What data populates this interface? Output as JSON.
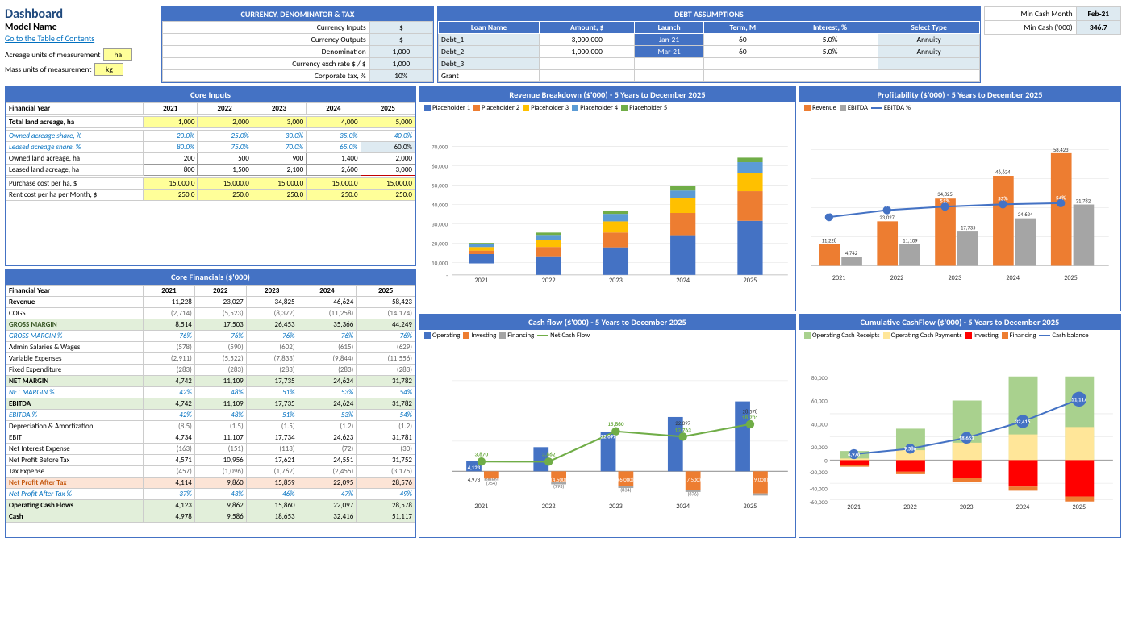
{
  "header": {
    "title_dashboard": "Dashboard",
    "title_model": "Model Name",
    "link_toc": "Go to the Table of Contents",
    "acreage_label": "Acreage units of measurement",
    "acreage_value": "ha",
    "mass_label": "Mass units of measurement",
    "mass_value": "kg"
  },
  "currency": {
    "title": "CURRENCY, DENOMINATOR & TAX",
    "rows": [
      {
        "label": "Currency Inputs",
        "value": "$"
      },
      {
        "label": "Currency Outputs",
        "value": "$"
      },
      {
        "label": "Denomination",
        "value": "1,000"
      },
      {
        "label": "Currency exch rate $ / $",
        "value": "1,000"
      },
      {
        "label": "Corporate tax, %",
        "value": "10%"
      }
    ]
  },
  "debt": {
    "title": "DEBT ASSUMPTIONS",
    "headers": [
      "Loan Name",
      "Amount, $",
      "Launch",
      "Term, M",
      "Interest, %",
      "Select Type"
    ],
    "rows": [
      {
        "name": "Debt_1",
        "amount": "3,000,000",
        "launch": "Jan-21",
        "term": "60",
        "interest": "5.0%",
        "type": "Annuity"
      },
      {
        "name": "Debt_2",
        "amount": "1,000,000",
        "launch": "Mar-21",
        "term": "60",
        "interest": "5.0%",
        "type": "Annuity"
      },
      {
        "name": "Debt_3",
        "amount": "",
        "launch": "",
        "term": "",
        "interest": "",
        "type": ""
      },
      {
        "name": "Grant",
        "amount": "",
        "launch": "",
        "term": "",
        "interest": "",
        "type": ""
      }
    ]
  },
  "mincash": {
    "label1": "Min Cash Month",
    "value1": "Feb-21",
    "label2": "Min Cash ('000)",
    "value2": "346.7"
  },
  "core_inputs": {
    "title": "Core Inputs",
    "fy_label": "Financial Year",
    "years": [
      "2021",
      "2022",
      "2023",
      "2024",
      "2025"
    ],
    "rows": [
      {
        "label": "Total land acreage, ha",
        "type": "yellow",
        "values": [
          "1,000",
          "2,000",
          "3,000",
          "4,000",
          "5,000"
        ]
      },
      {
        "label": "Owned acreage share, %",
        "type": "italic_blue",
        "values": [
          "20.0%",
          "25.0%",
          "30.0%",
          "35.0%",
          "40.0%"
        ]
      },
      {
        "label": "Leased acreage share, %",
        "type": "italic_blue",
        "values": [
          "80.0%",
          "75.0%",
          "70.0%",
          "65.0%",
          "60.0%"
        ]
      },
      {
        "label": "Owned land acreage, ha",
        "type": "bordered",
        "values": [
          "200",
          "500",
          "900",
          "1,400",
          "2,000"
        ]
      },
      {
        "label": "Leased land acreage, ha",
        "type": "bordered",
        "values": [
          "800",
          "1,500",
          "2,100",
          "2,600",
          "3,000"
        ]
      },
      {
        "label": "Purchase cost per ha, $",
        "type": "yellow",
        "values": [
          "15,000.0",
          "15,000.0",
          "15,000.0",
          "15,000.0",
          "15,000.0"
        ]
      },
      {
        "label": "Rent cost per ha per Month, $",
        "type": "yellow",
        "values": [
          "250.0",
          "250.0",
          "250.0",
          "250.0",
          "250.0"
        ]
      }
    ]
  },
  "core_financials": {
    "title": "Core Financials ($'000)",
    "fy_label": "Financial Year",
    "years": [
      "2021",
      "2022",
      "2023",
      "2024",
      "2025"
    ],
    "rows": [
      {
        "label": "Revenue",
        "style": "bold",
        "values": [
          "11,228",
          "23,027",
          "34,825",
          "46,624",
          "58,423"
        ]
      },
      {
        "label": "COGS",
        "style": "normal",
        "values": [
          "(2,714)",
          "(5,523)",
          "(8,372)",
          "(11,258)",
          "(14,174)"
        ]
      },
      {
        "label": "GROSS MARGIN",
        "style": "green_bold",
        "values": [
          "8,514",
          "17,503",
          "26,453",
          "35,366",
          "44,249"
        ]
      },
      {
        "label": "GROSS MARGIN %",
        "style": "blue_italic",
        "values": [
          "76%",
          "76%",
          "76%",
          "76%",
          "76%"
        ]
      },
      {
        "label": "Admin Salaries & Wages",
        "style": "normal",
        "values": [
          "(578)",
          "(590)",
          "(602)",
          "(615)",
          "(629)"
        ]
      },
      {
        "label": "Variable Expenses",
        "style": "normal",
        "values": [
          "(2,911)",
          "(5,522)",
          "(7,833)",
          "(9,844)",
          "(11,556)"
        ]
      },
      {
        "label": "Fixed Expenditure",
        "style": "normal",
        "values": [
          "(283)",
          "(283)",
          "(283)",
          "(283)",
          "(283)"
        ]
      },
      {
        "label": "NET MARGIN",
        "style": "bold",
        "values": [
          "4,742",
          "11,109",
          "17,735",
          "24,624",
          "31,782"
        ]
      },
      {
        "label": "NET MARGIN %",
        "style": "blue_italic",
        "values": [
          "42%",
          "48%",
          "51%",
          "53%",
          "54%"
        ]
      },
      {
        "label": "EBITDA",
        "style": "bold",
        "values": [
          "4,742",
          "11,109",
          "17,735",
          "24,624",
          "31,782"
        ]
      },
      {
        "label": "EBITDA %",
        "style": "blue_italic",
        "values": [
          "42%",
          "48%",
          "51%",
          "53%",
          "54%"
        ]
      },
      {
        "label": "Depreciation & Amortization",
        "style": "normal",
        "values": [
          "(8.5)",
          "(1.5)",
          "(1.5)",
          "(1.2)",
          "(1.2)"
        ]
      },
      {
        "label": "EBIT",
        "style": "normal",
        "values": [
          "4,734",
          "11,107",
          "17,734",
          "24,623",
          "31,781"
        ]
      },
      {
        "label": "Net Interest Expense",
        "style": "normal",
        "values": [
          "(163)",
          "(151)",
          "(113)",
          "(72)",
          "(30)"
        ]
      },
      {
        "label": "Net Profit Before Tax",
        "style": "normal",
        "values": [
          "4,571",
          "10,956",
          "17,621",
          "24,551",
          "31,752"
        ]
      },
      {
        "label": "Tax Expense",
        "style": "normal",
        "values": [
          "(457)",
          "(1,096)",
          "(1,762)",
          "(2,455)",
          "(3,175)"
        ]
      },
      {
        "label": "Net Profit After Tax",
        "style": "orange_bold",
        "values": [
          "4,114",
          "9,860",
          "15,859",
          "22,095",
          "28,576"
        ]
      },
      {
        "label": "Net Profit After Tax %",
        "style": "blue_italic",
        "values": [
          "37%",
          "43%",
          "46%",
          "47%",
          "49%"
        ]
      },
      {
        "label": "Operating Cash Flows",
        "style": "bold",
        "values": [
          "4,123",
          "9,862",
          "15,860",
          "22,097",
          "28,578"
        ]
      },
      {
        "label": "Cash",
        "style": "bold",
        "values": [
          "4,978",
          "9,586",
          "18,653",
          "32,416",
          "51,117"
        ]
      }
    ]
  },
  "revenue_chart": {
    "title": "Revenue Breakdown ($'000) - 5 Years to December 2025",
    "legend": [
      "Placeholder 1",
      "Placeholder 2",
      "Placeholder 3",
      "Placeholder 4",
      "Placeholder 5"
    ],
    "colors": [
      "#4472C4",
      "#ED7D31",
      "#FFC000",
      "#5B9BD5",
      "#70AD47"
    ],
    "years": [
      "2021",
      "2022",
      "2023",
      "2024",
      "2025"
    ],
    "max_y": 70000,
    "y_labels": [
      "70,000",
      "60,000",
      "50,000",
      "40,000",
      "30,000",
      "20,000",
      "10,000",
      "-"
    ],
    "bars": [
      [
        5000,
        2000,
        2000,
        1500,
        700
      ],
      [
        10000,
        5000,
        4000,
        2500,
        1527
      ],
      [
        15000,
        8000,
        6000,
        4000,
        1825
      ],
      [
        20000,
        12000,
        8000,
        4000,
        2624
      ],
      [
        25000,
        16000,
        10000,
        5000,
        2423
      ]
    ]
  },
  "cashflow_chart": {
    "title": "Cash flow ($'000) - 5 Years to December 2025",
    "legend": [
      "Operating",
      "Investing",
      "Financing",
      "Net Cash Flow"
    ],
    "colors": [
      "#4472C4",
      "#ED7D31",
      "#A5A5A5",
      "#70AD47"
    ],
    "years": [
      "2021",
      "2022",
      "2023",
      "2024",
      "2025"
    ],
    "bars": {
      "operating": [
        4123,
        9862,
        15860,
        22097,
        28578
      ],
      "investing": [
        -3014,
        -4500,
        -6000,
        -7500,
        -9000
      ],
      "financing": [
        -754,
        -793,
        -834,
        -876,
        -876
      ],
      "net": [
        3870,
        3862,
        15860,
        13763,
        18701
      ]
    },
    "labels": {
      "net_top": [
        "3,870",
        "3,862",
        "15,860",
        "13,763",
        "18,701"
      ],
      "op_top": [
        "4,123",
        "4,978",
        "",
        "",
        ""
      ],
      "inv_bot": [
        "(3,014)",
        "(4,500)",
        "(6,000)",
        "(7,500)",
        "(9,000)"
      ],
      "fin_bot": [
        "(754)",
        "(793)",
        "(834)",
        "(876)",
        ""
      ],
      "extra": [
        "",
        "",
        "22,097",
        "28,578",
        ""
      ]
    }
  },
  "profitability_chart": {
    "title": "Profitability ($'000) - 5 Years to December 2025",
    "legend": [
      "Revenue",
      "EBITDA",
      "EBITDA %"
    ],
    "colors_bar": [
      "#ED7D31",
      "#A5A5A5"
    ],
    "color_line": "#4472C4",
    "years": [
      "2021",
      "2022",
      "2023",
      "2024",
      "2025"
    ],
    "revenue": [
      11228,
      23027,
      34825,
      46624,
      58423
    ],
    "ebitda": [
      4742,
      11109,
      17735,
      24624,
      31782
    ],
    "ebitda_pct": [
      42,
      48,
      51,
      53,
      54
    ],
    "labels_rev": [
      "11,228",
      "23,027",
      "34,825",
      "46,624",
      "58,423"
    ],
    "labels_ebitda": [
      "4,742",
      "11,109",
      "17,735",
      "24,624",
      "31,782"
    ],
    "labels_pct": [
      "42%",
      "48%",
      "51%",
      "53%",
      "54%"
    ]
  },
  "cumcf_chart": {
    "title": "Cumulative CashFlow ($'000) - 5 Years to December 2025",
    "legend": [
      "Operating Cash Receipts",
      "Operating Cash Payments",
      "Investing",
      "Financing",
      "Cash balance"
    ],
    "colors": [
      "#A9D18E",
      "#FFE699",
      "#FF0000",
      "#ED7D31",
      "#4472C4"
    ],
    "years": [
      "2021",
      "2022",
      "2023",
      "2024",
      "2025"
    ],
    "cash_labels": [
      "4,978",
      "9,586",
      "18,653",
      "32,416",
      "51,117"
    ]
  }
}
